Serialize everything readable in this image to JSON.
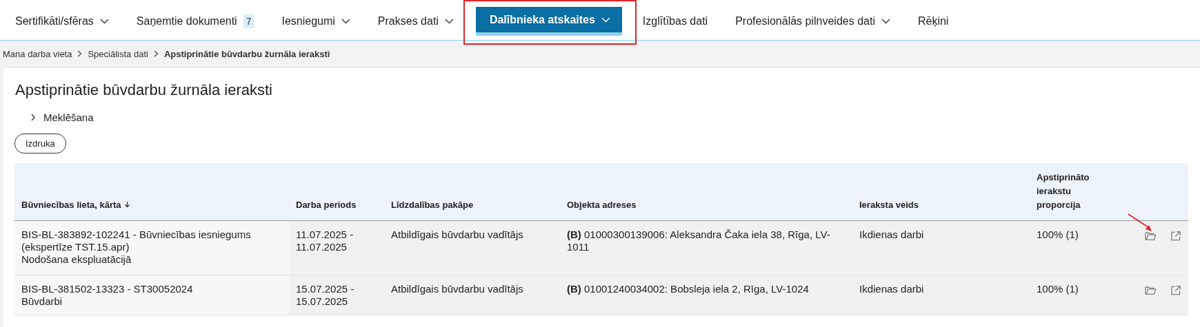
{
  "nav": {
    "tabs": [
      {
        "label": "Sertifikāti/sfēras",
        "dropdown": true,
        "selected": false,
        "highlighted": false
      },
      {
        "label": "Saņemtie dokumenti",
        "badge": "7",
        "dropdown": false,
        "selected": false,
        "highlighted": false
      },
      {
        "label": "Iesniegumi",
        "dropdown": true,
        "selected": false,
        "highlighted": false
      },
      {
        "label": "Prakses dati",
        "dropdown": true,
        "selected": false,
        "highlighted": false
      },
      {
        "label": "Dalībnieka atskaites",
        "dropdown": true,
        "selected": true,
        "highlighted": true
      },
      {
        "label": "Izglītības dati",
        "dropdown": false,
        "selected": false,
        "highlighted": false
      },
      {
        "label": "Profesionālās pilnveides dati",
        "dropdown": true,
        "selected": false,
        "highlighted": false
      },
      {
        "label": "Rēķini",
        "dropdown": false,
        "selected": false,
        "highlighted": false
      }
    ]
  },
  "breadcrumb": [
    "Mana darba vieta",
    "Speciālista dati",
    "Apstiprinātie būvdarbu žurnāla ieraksti"
  ],
  "page": {
    "title": "Apstiprinātie būvdarbu žurnāla ieraksti",
    "search_toggle": {
      "label": "Meklēšana",
      "expanded": false
    },
    "print_button": "Izdruka"
  },
  "table": {
    "columns": [
      {
        "label": "Būvniecības lieta, kārta",
        "sorted": true
      },
      {
        "label": "Darba periods",
        "sorted": false
      },
      {
        "label": "Līdzdalības pakāpe",
        "sorted": false
      },
      {
        "label": "Objekta adreses",
        "sorted": false
      },
      {
        "label": "Ieraksta veids",
        "sorted": false
      },
      {
        "label": "Apstiprināto ierakstu proporcija",
        "sorted": false
      }
    ],
    "rows": [
      {
        "case": "BIS-BL-383892-102241 - Būvniecības iesniegums (ekspertīze TST.15.apr)",
        "stage": "Nodošana ekspluatācijā",
        "period": "11.07.2025 - 11.07.2025",
        "role": "Atbildīgais būvdarbu vadītājs",
        "address": "**(B)** 01000300139006: Aleksandra Čaka iela 38, Rīga, LV-1011",
        "entry_type": "Ikdienas darbi",
        "proportion": "100% (1)",
        "pointed": true
      },
      {
        "case": "BIS-BL-381502-13323 - ST30052024",
        "stage": "Būvdarbi",
        "period": "15.07.2025 - 15.07.2025",
        "role": "Atbildīgais būvdarbu vadītājs",
        "address": "**(B)** 01001240034002: Bobsleja iela 2, Rīga, LV-1024",
        "entry_type": "Ikdienas darbi",
        "proportion": "100% (1)",
        "pointed": false
      }
    ]
  }
}
